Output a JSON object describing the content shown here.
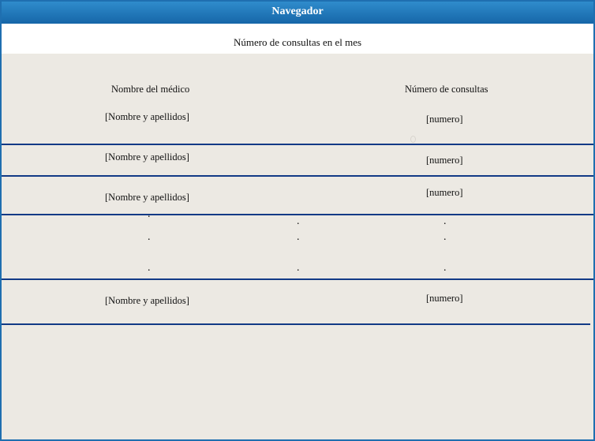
{
  "window": {
    "title": "Navegador"
  },
  "report": {
    "subtitle": "Número de consultas en el mes",
    "columns": {
      "doctor": "Nombre del médico",
      "count": "Número de consultas"
    },
    "rows": [
      {
        "name": "[Nombre y apellidos]",
        "count": "[numero]"
      },
      {
        "name": "[Nombre y apellidos]",
        "count": "[numero]"
      },
      {
        "name": "[Nombre y apellidos]",
        "count": "[numero]"
      },
      {
        "name": "[Nombre y apellidos]",
        "count": "[numero]"
      }
    ],
    "ellipsis": "."
  }
}
